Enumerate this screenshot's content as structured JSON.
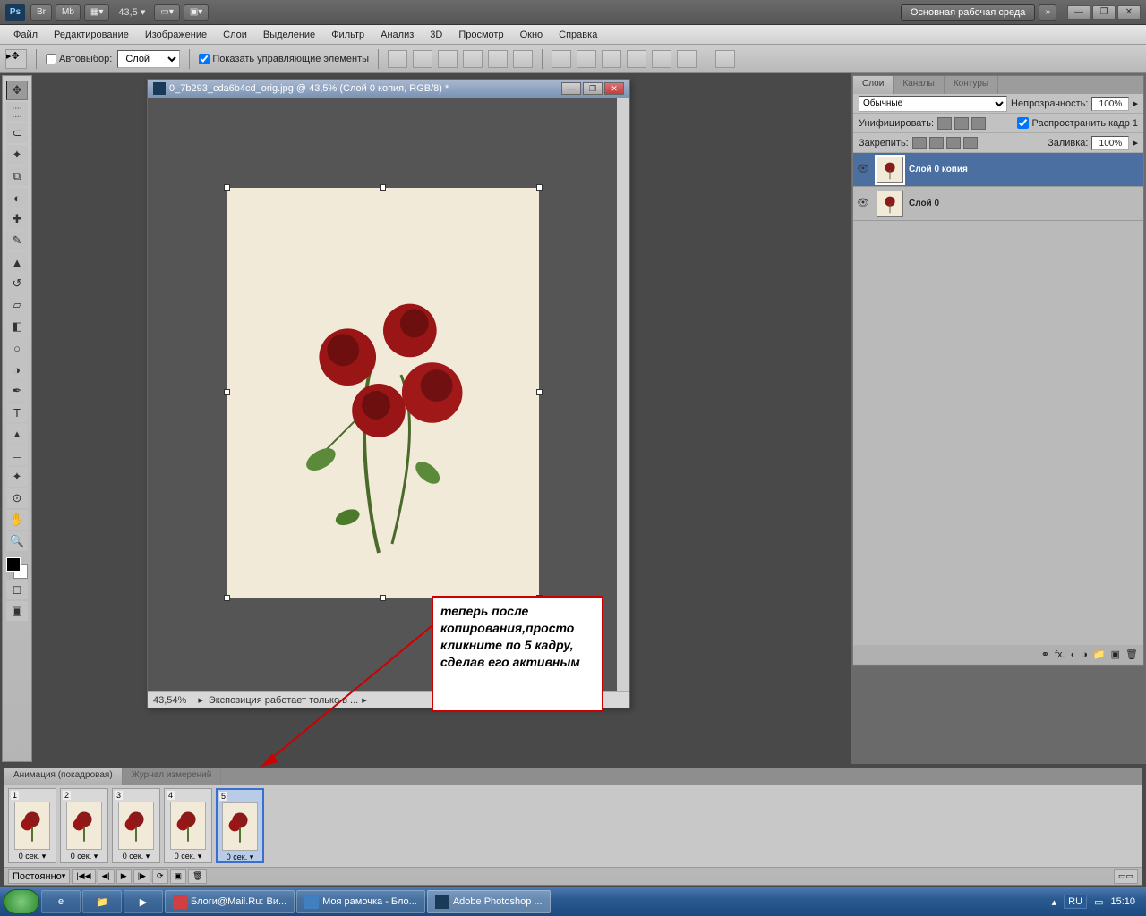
{
  "titlebar": {
    "ps": "Ps",
    "br": "Br",
    "mb": "Mb",
    "zoom": "43,5",
    "workspace_label": "Основная рабочая среда"
  },
  "menu": {
    "items": [
      "Файл",
      "Редактирование",
      "Изображение",
      "Слои",
      "Выделение",
      "Фильтр",
      "Анализ",
      "3D",
      "Просмотр",
      "Окно",
      "Справка"
    ]
  },
  "optbar": {
    "autoselect": "Автовыбор:",
    "autoselect_val": "Слой",
    "show_controls": "Показать управляющие элементы"
  },
  "doc": {
    "title": "0_7b293_cda6b4cd_orig.jpg @ 43,5% (Слой 0 копия, RGB/8) *",
    "zoom_status": "43,54%",
    "status_text": "Экспозиция работает только в ..."
  },
  "annotation": {
    "text": "теперь  после копирования,просто кликните по 5 кадру, сделав его активным"
  },
  "layers_panel": {
    "tabs": [
      "Слои",
      "Каналы",
      "Контуры"
    ],
    "blend": "Обычные",
    "opacity_label": "Непрозрачность:",
    "opacity": "100%",
    "unify": "Унифицировать:",
    "propagate": "Распространить кадр 1",
    "lock": "Закрепить:",
    "fill_label": "Заливка:",
    "fill": "100%",
    "layers": [
      {
        "name": "Слой 0 копия",
        "selected": true
      },
      {
        "name": "Слой 0",
        "selected": false
      }
    ]
  },
  "animation": {
    "tabs": [
      "Анимация (покадровая)",
      "Журнал измерений"
    ],
    "frames": [
      {
        "n": "1",
        "time": "0 сек.",
        "selected": false
      },
      {
        "n": "2",
        "time": "0 сек.",
        "selected": false
      },
      {
        "n": "3",
        "time": "0 сек.",
        "selected": false
      },
      {
        "n": "4",
        "time": "0 сек.",
        "selected": false
      },
      {
        "n": "5",
        "time": "0 сек.",
        "selected": true
      }
    ],
    "loop": "Постоянно"
  },
  "taskbar": {
    "items": [
      {
        "label": "Блоги@Mail.Ru: Ви...",
        "active": false
      },
      {
        "label": "Моя рамочка - Бло...",
        "active": false
      },
      {
        "label": "Adobe Photoshop ...",
        "active": true
      }
    ],
    "lang": "RU",
    "time": "15:10"
  }
}
